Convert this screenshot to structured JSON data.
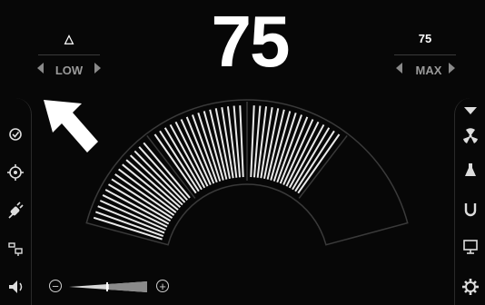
{
  "display": {
    "value": "75"
  },
  "left_panel": {
    "top_symbol": "△",
    "level_label": "LOW"
  },
  "right_panel": {
    "top_value": "75",
    "level_label": "MAX"
  },
  "gauge": {
    "fill_fraction": 0.75,
    "segments": 4,
    "filled_segments": 3
  },
  "slider": {
    "minus_label": "−",
    "plus_label": "+"
  },
  "left_icons": [
    "check-circle-icon",
    "target-icon",
    "plug-icon",
    "display-switch-icon",
    "speaker-icon"
  ],
  "right_icons": [
    "down-arrow-icon",
    "radiation-icon",
    "flask-icon",
    "magnet-icon",
    "monitor-icon",
    "gear-icon"
  ],
  "colors": {
    "background": "#000000",
    "accent": "#ffffff",
    "muted": "#9a9a9a",
    "arrow": "#ffffff"
  }
}
